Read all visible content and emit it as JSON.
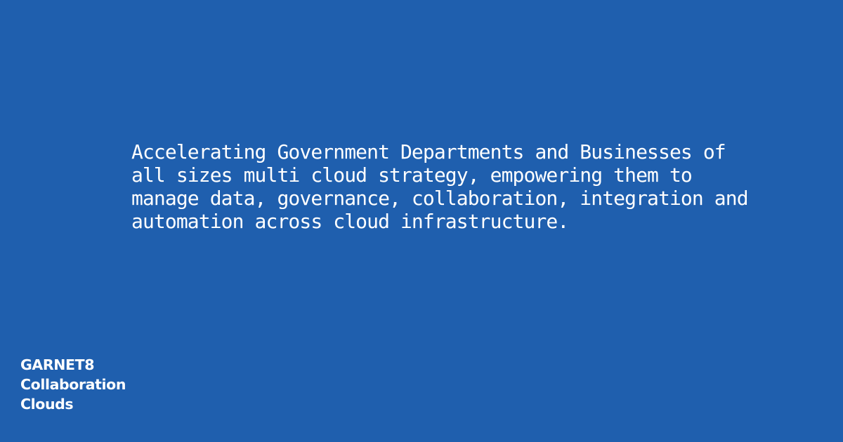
{
  "tagline": {
    "lines": [
      "Accelerating Government Departments and Businesses of",
      "all sizes multi cloud strategy, empowering them to",
      "manage data, governance, collaboration, integration and",
      "automation across cloud infrastructure."
    ]
  },
  "brand": {
    "lines": [
      "GARNET8",
      "Collaboration",
      "Clouds"
    ]
  },
  "colors": {
    "background": "#1f5fae",
    "text": "#ffffff"
  }
}
